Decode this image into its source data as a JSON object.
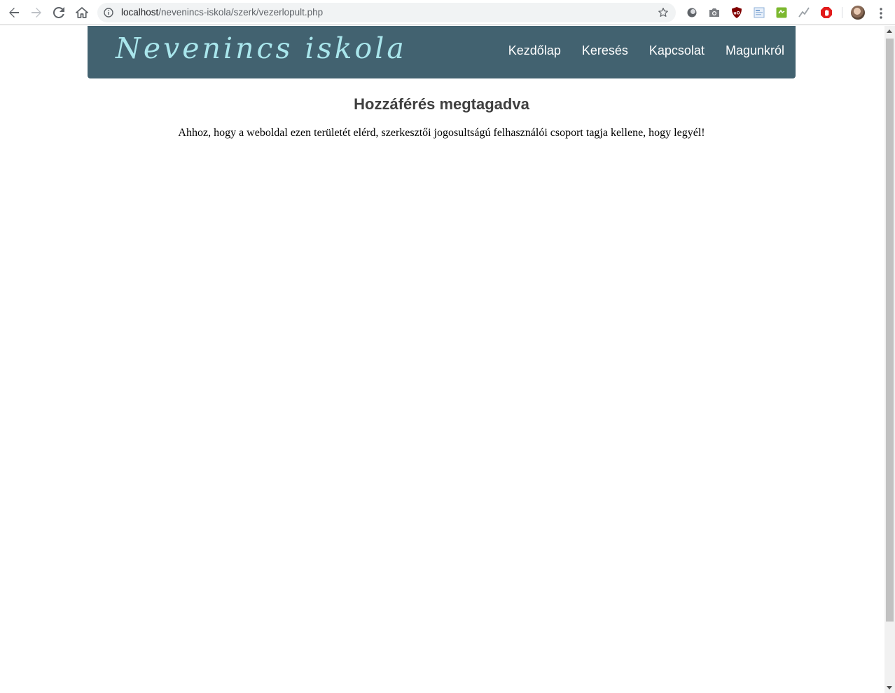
{
  "browser": {
    "url_host": "localhost",
    "url_path": "/nevenincs-iskola/szerk/vezerlopult.php",
    "icons": {
      "back": "back-arrow-icon",
      "forward": "forward-arrow-icon",
      "reload": "reload-icon",
      "home": "home-icon",
      "info": "info-icon",
      "bookmark": "star-icon",
      "menu": "kebab-menu-icon"
    },
    "extensions": [
      "circle-extension-icon",
      "camera-icon",
      "ublock-icon",
      "page-extension-icon",
      "green-extension-icon",
      "activity-icon",
      "adblock-icon"
    ]
  },
  "site": {
    "logo": "Nevenincs iskola",
    "header_color": "#426270",
    "logo_color": "#a9e6ec",
    "nav": [
      "Kezdőlap",
      "Keresés",
      "Kapcsolat",
      "Magunkról"
    ]
  },
  "content": {
    "title": "Hozzáférés megtagadva",
    "message": "Ahhoz, hogy a weboldal ezen területét elérd, szerkesztői jogosultságú felhasználói csoport tagja kellene, hogy legyél!"
  }
}
